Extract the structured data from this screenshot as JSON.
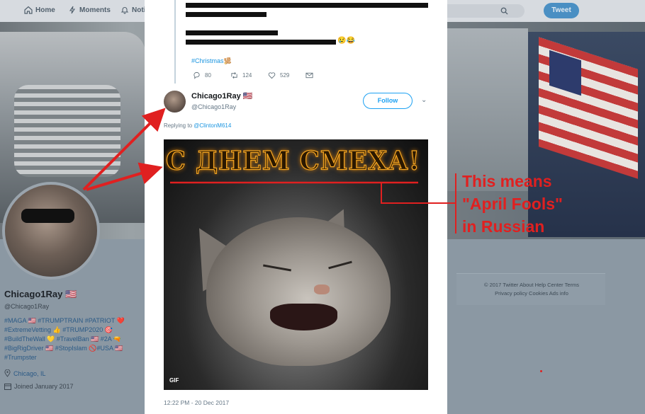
{
  "nav": {
    "home": "Home",
    "moments": "Moments",
    "notifications": "Noti",
    "tweet_button": "Tweet"
  },
  "thread": {
    "hashtag": "#Christmas🫚",
    "replies": "80",
    "retweets": "124",
    "likes": "529"
  },
  "tweet": {
    "author_name": "Chicago1Ray 🇺🇸",
    "author_handle": "@Chicago1Ray",
    "follow_label": "Follow",
    "replying_prefix": "Replying to ",
    "replying_to": "@ClintonM614",
    "gif_text": "С ДНЕМ СМЕХА!",
    "gif_badge": "GIF",
    "timestamp": "12:22 PM - 20 Dec 2017"
  },
  "profile": {
    "name": "Chicago1Ray 🇺🇸",
    "handle": "@Chicago1Ray",
    "bio_lines": [
      "#MAGA 🇺🇸 #TRUMPTRAIN #PATRIOT ❤️",
      "#ExtremeVetting 👍 #TRUMP2020 🎯",
      "#BuildTheWall 💛 #TravelBan 🇺🇸 #2A 🔫",
      "#BigRigDriver 🇺🇸 #StopIslam 🚫#USA 🇺🇸",
      "#Trumpster"
    ],
    "location": "Chicago, IL",
    "joined": "Joined January 2017"
  },
  "footer": {
    "line1": "© 2017 Twitter   About   Help Center   Terms",
    "line2": "Privacy policy   Cookies   Ads info"
  },
  "annotation": {
    "lines": [
      "This means",
      "\"April Fools\"",
      "in Russian"
    ],
    "color": "#e02020"
  },
  "colors": {
    "accent": "#1da1f2",
    "link": "#1b95e0",
    "tweet_button": "#4a8fc3"
  }
}
